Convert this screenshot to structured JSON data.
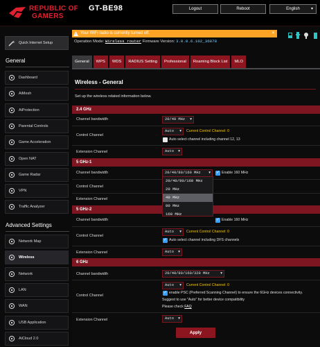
{
  "header": {
    "logo_line1": "REPUBLIC OF",
    "logo_line2": "GAMERS",
    "model": "GT-BE98",
    "logout_label": "Logout",
    "reboot_label": "Reboot",
    "language": "English"
  },
  "sidebar": {
    "quick_setup": "Quick Internet Setup",
    "general_title": "General",
    "general_items": [
      {
        "label": "Dashboard",
        "icon": "dashboard-icon"
      },
      {
        "label": "AiMesh",
        "icon": "aimesh-icon"
      },
      {
        "label": "AiProtection",
        "icon": "shield-icon"
      },
      {
        "label": "Parental Controls",
        "icon": "parental-icon"
      },
      {
        "label": "Game Acceleration",
        "icon": "rocket-icon"
      },
      {
        "label": "Open NAT",
        "icon": "nat-icon"
      },
      {
        "label": "Game Radar",
        "icon": "radar-icon"
      },
      {
        "label": "VPN",
        "icon": "vpn-icon"
      },
      {
        "label": "Traffic Analyzer",
        "icon": "analyzer-icon"
      }
    ],
    "advanced_title": "Advanced Settings",
    "advanced_items": [
      {
        "label": "Network Map",
        "icon": "network-map-icon"
      },
      {
        "label": "Wireless",
        "icon": "wireless-icon"
      },
      {
        "label": "Network",
        "icon": "network-icon"
      },
      {
        "label": "LAN",
        "icon": "lan-icon"
      },
      {
        "label": "WAN",
        "icon": "wan-icon"
      },
      {
        "label": "USB Application",
        "icon": "usb-icon"
      },
      {
        "label": "AiCloud 2.0",
        "icon": "cloud-icon"
      }
    ]
  },
  "status": {
    "warning": "Your WiFi radio is currently turned off.",
    "op_mode_label": "Operation Mode:",
    "op_mode_value": "Wireless router",
    "fw_label": "Firmware Version:",
    "fw_value": "3.0.0.6.102_36878"
  },
  "tabs": [
    "General",
    "WPS",
    "WDS",
    "RADIUS Setting",
    "Professional",
    "Roaming Block List",
    "MLO"
  ],
  "page": {
    "title": "Wireless - General",
    "description": "Set up the wireless related information below."
  },
  "bands": {
    "b24": {
      "name": "2.4 GHz",
      "bw_label": "Channel bandwidth",
      "bw_value": "20/40 MHz",
      "cc_label": "Control Channel",
      "cc_value": "Auto",
      "cc_current": "Current Control Channel: 0",
      "cc_note": "Auto select channel including channel 12, 13",
      "ext_label": "Extension Channel",
      "ext_value": "Auto"
    },
    "b51": {
      "name": "5 GHz-1",
      "bw_label": "Channel bandwidth",
      "bw_value": "20/40/80/160 MHz",
      "enable160": "Enable 160 MHz",
      "cc_label": "Control Channel",
      "ext_label": "Extension Channel"
    },
    "b52": {
      "name": "5 GHz-2",
      "bw_label": "Channel bandwidth",
      "enable160": "Enable 160 MHz",
      "cc_label": "Control Channel",
      "cc_value": "Auto",
      "cc_current": "Current Control Channel: 0",
      "cc_note": "Auto select channel including DFS channels",
      "ext_label": "Extension Channel",
      "ext_value": "Auto"
    },
    "b6": {
      "name": "6 GHz",
      "bw_label": "Channel bandwidth",
      "bw_value": "20/40/80/160/320 MHz",
      "cc_label": "Control Channel",
      "cc_value": "Auto",
      "cc_current": "Current Control Channel: 0",
      "psc_note": "enable PSC (Preferred Scanning Channel) to ensure the 6GHz devices connectivity.",
      "suggest": "Suggest to use \"Auto\" for better device compatibility",
      "check_label": "Please check ",
      "faq": "FAQ",
      "ext_label": "Extension Channel",
      "ext_value": "Auto"
    }
  },
  "dropdown": {
    "options": [
      "20/40/80/160 MHz",
      "20 MHz",
      "40 MHz",
      "80 MHz",
      "160 MHz"
    ],
    "highlighted": "40 MHz"
  },
  "apply_label": "Apply",
  "colors": {
    "accent": "#8d1520",
    "warning": "#fda427",
    "brand": "#e0202e",
    "current_channel": "#f1c40f"
  }
}
